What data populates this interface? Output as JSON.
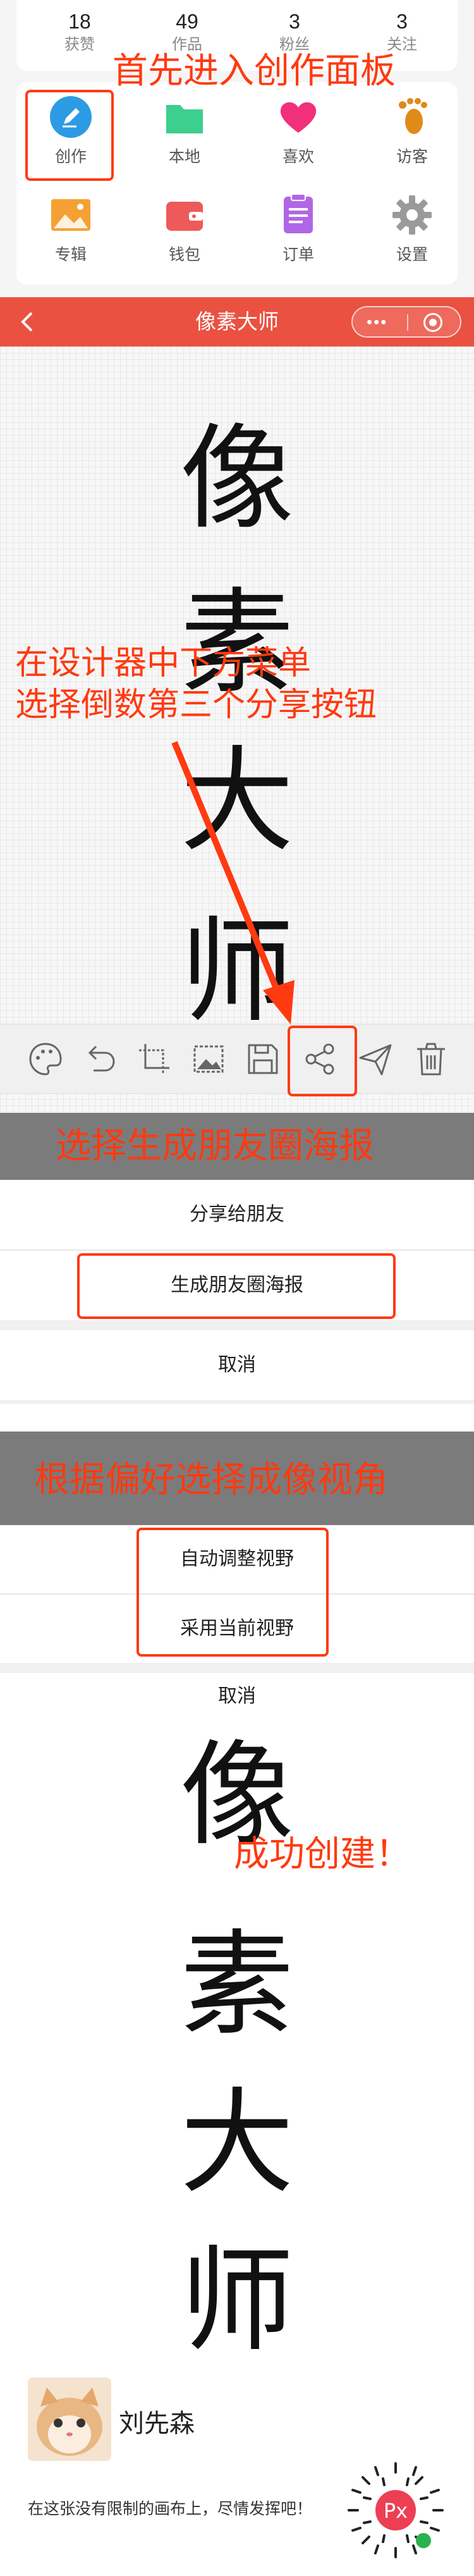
{
  "profile": {
    "stats": [
      {
        "num": "18",
        "label": "获赞"
      },
      {
        "num": "49",
        "label": "作品"
      },
      {
        "num": "3",
        "label": "粉丝"
      },
      {
        "num": "3",
        "label": "关注"
      }
    ],
    "menu": [
      {
        "label": "创作",
        "icon": "create-pencil-icon",
        "color": "#2d9be3"
      },
      {
        "label": "本地",
        "icon": "folder-icon",
        "color": "#3ccf8e"
      },
      {
        "label": "喜欢",
        "icon": "heart-icon",
        "color": "#f0307a"
      },
      {
        "label": "访客",
        "icon": "footprint-icon",
        "color": "#e08a1a"
      },
      {
        "label": "专辑",
        "icon": "picture-icon",
        "color": "#f5a033"
      },
      {
        "label": "钱包",
        "icon": "wallet-icon",
        "color": "#ee5a5a"
      },
      {
        "label": "订单",
        "icon": "order-list-icon",
        "color": "#b067e6"
      },
      {
        "label": "设置",
        "icon": "gear-icon",
        "color": "#9a9a9a"
      }
    ]
  },
  "editor": {
    "title": "像素大师",
    "capsule_dots": "•••",
    "canvas_chars": [
      "像",
      "素",
      "大",
      "师"
    ],
    "toolbar": [
      "palette-icon",
      "undo-icon",
      "crop-icon",
      "image-icon",
      "save-icon",
      "share-icon",
      "send-icon",
      "trash-icon"
    ]
  },
  "share_sheet": {
    "share_friends": "分享给朋友",
    "moments_poster": "生成朋友圈海报",
    "cancel": "取消"
  },
  "view_sheet": {
    "auto_view": "自动调整视野",
    "current_view": "采用当前视野",
    "cancel": "取消"
  },
  "poster": {
    "chars": [
      "像",
      "素",
      "大",
      "师"
    ],
    "username": "刘先森",
    "slogan": "在这张没有限制的画布上，尽情发挥吧！",
    "qr_logo": "Px"
  },
  "annotations": {
    "step1": "首先进入创作面板",
    "step2_line1": "在设计器中下方菜单",
    "step2_line2": "选择倒数第三个分享按钮",
    "step3": "选择生成朋友圈海报",
    "step4": "根据偏好选择成像视角",
    "step5": "成功创建！"
  },
  "colors": {
    "navbar": "#ea5141",
    "annotation": "#ff3a10"
  }
}
